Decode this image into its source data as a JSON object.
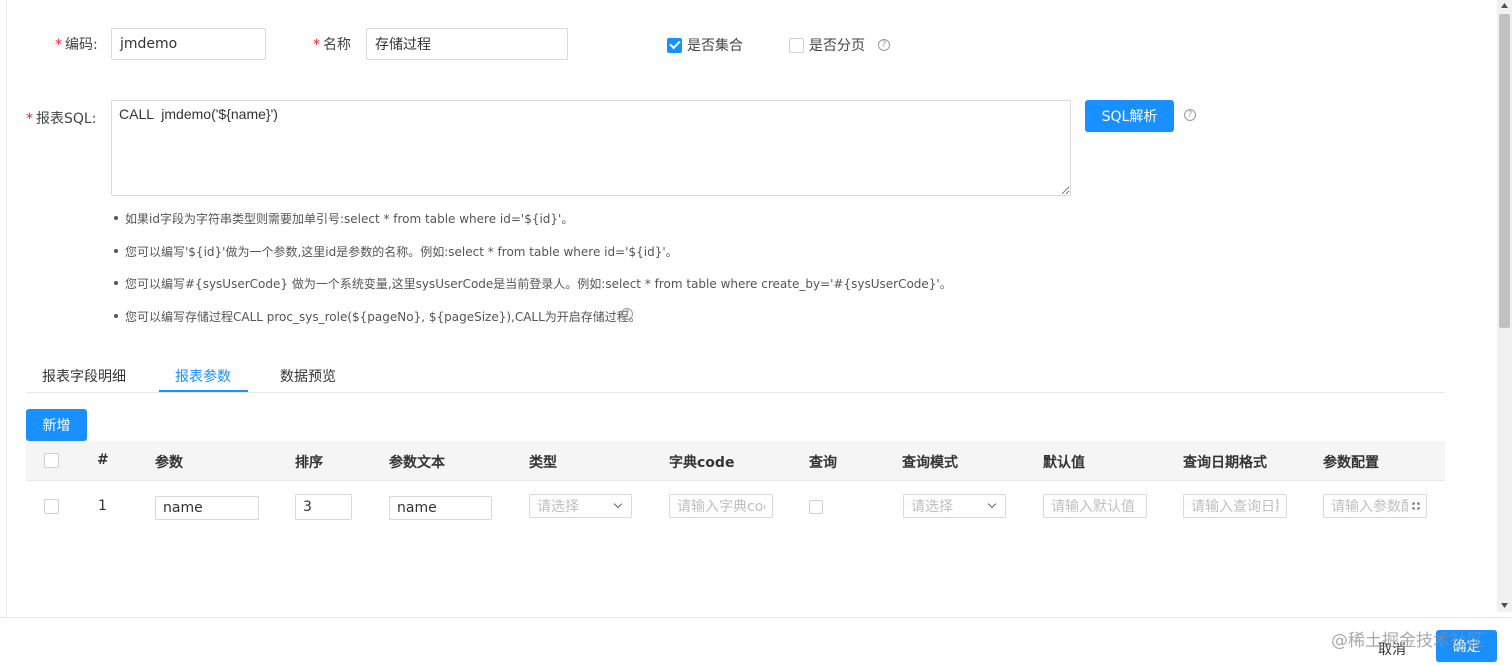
{
  "form": {
    "code_label": "编码:",
    "code_value": "jmdemo",
    "name_label": "名称",
    "name_value": "存储过程",
    "collection_label": "是否集合",
    "paging_label": "是否分页",
    "sql_label": "报表SQL:",
    "sql_value": "CALL  jmdemo('${name}')",
    "sql_parse_button": "SQL解析",
    "help_glyph": "?"
  },
  "tips": [
    "如果id字段为字符串类型则需要加单引号:select * from table where id='${id}'。",
    "您可以编写'${id}'做为一个参数,这里id是参数的名称。例如:select * from table where id='${id}'。",
    "您可以编写#{sysUserCode} 做为一个系统变量,这里sysUserCode是当前登录人。例如:select * from table where create_by='#{sysUserCode}'。",
    "您可以编写存储过程CALL proc_sys_role(${pageNo}, ${pageSize}),CALL为开启存储过程。"
  ],
  "tabs": [
    {
      "label": "报表字段明细",
      "active": false
    },
    {
      "label": "报表参数",
      "active": true
    },
    {
      "label": "数据预览",
      "active": false
    }
  ],
  "add_button": "新增",
  "table": {
    "headers": [
      "#",
      "参数",
      "排序",
      "参数文本",
      "类型",
      "字典code",
      "查询",
      "查询模式",
      "默认值",
      "查询日期格式",
      "参数配置"
    ],
    "rows": [
      {
        "index": "1",
        "param": "name",
        "order": "3",
        "param_text": "name",
        "type_placeholder": "请选择",
        "dict_placeholder": "请输入字典code",
        "mode_placeholder": "请选择",
        "default_placeholder": "请输入默认值",
        "date_placeholder": "请输入查询日期格式",
        "config_placeholder": "请输入参数配置"
      }
    ]
  },
  "footer": {
    "watermark": "@稀土掘金技术社区",
    "cancel_label": "取消",
    "confirm_label": "确定"
  },
  "colors": {
    "primary": "#1890ff",
    "required": "#f5222d"
  }
}
